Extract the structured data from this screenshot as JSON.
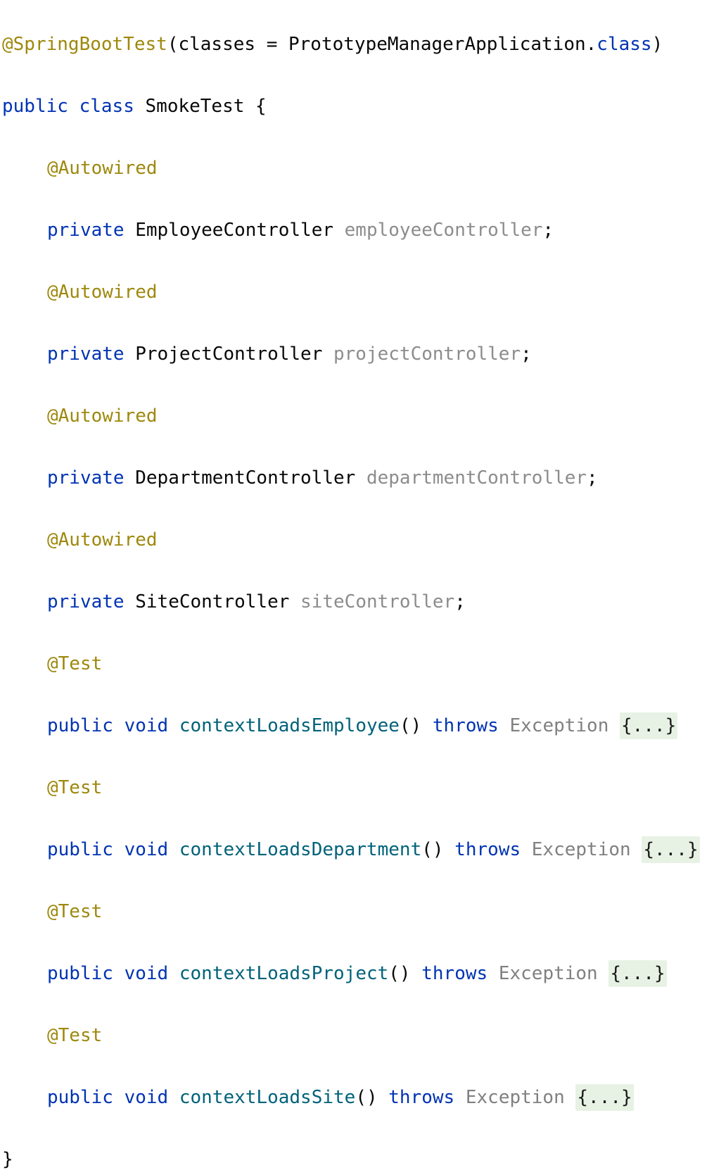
{
  "editor": {
    "lines": [
      {
        "annotation": "@SpringBootTest",
        "args": "(classes = PrototypeManagerApplication.",
        "class_kw": "class",
        "close": ")"
      },
      {
        "kw1": "public",
        "kw2": "class",
        "name": "SmokeTest",
        "brace": " {"
      },
      {
        "annotation": "@Autowired"
      },
      {
        "kw": "private",
        "type": "EmployeeController",
        "field": "employeeController",
        "semi": ";"
      },
      {
        "annotation": "@Autowired"
      },
      {
        "kw": "private",
        "type": "ProjectController",
        "field": "projectController",
        "semi": ";"
      },
      {
        "annotation": "@Autowired"
      },
      {
        "kw": "private",
        "type": "DepartmentController",
        "field": "departmentController",
        "semi": ";"
      },
      {
        "annotation": "@Autowired"
      },
      {
        "kw": "private",
        "type": "SiteController",
        "field": "siteController",
        "semi": ";"
      },
      {
        "annotation": "@Test"
      },
      {
        "kw1": "public",
        "kw2": "void",
        "method": "contextLoadsEmployee",
        "parens": "()",
        "throws": "throws",
        "exception": "Exception",
        "fold": "{...}"
      },
      {
        "annotation": "@Test"
      },
      {
        "kw1": "public",
        "kw2": "void",
        "method": "contextLoadsDepartment",
        "parens": "()",
        "throws": "throws",
        "exception": "Exception",
        "fold": "{...}"
      },
      {
        "annotation": "@Test"
      },
      {
        "kw1": "public",
        "kw2": "void",
        "method": "contextLoadsProject",
        "parens": "()",
        "throws": "throws",
        "exception": "Exception",
        "fold": "{...}"
      },
      {
        "annotation": "@Test"
      },
      {
        "kw1": "public",
        "kw2": "void",
        "method": "contextLoadsSite",
        "parens": "()",
        "throws": "throws",
        "exception": "Exception",
        "fold": "{...}"
      },
      {
        "brace": "}"
      }
    ]
  },
  "colors": {
    "annotation": "#9e880d",
    "keyword": "#0033b3",
    "method": "#00627a",
    "field": "#8c8c8c",
    "fold_background": "#e8f2e4"
  }
}
